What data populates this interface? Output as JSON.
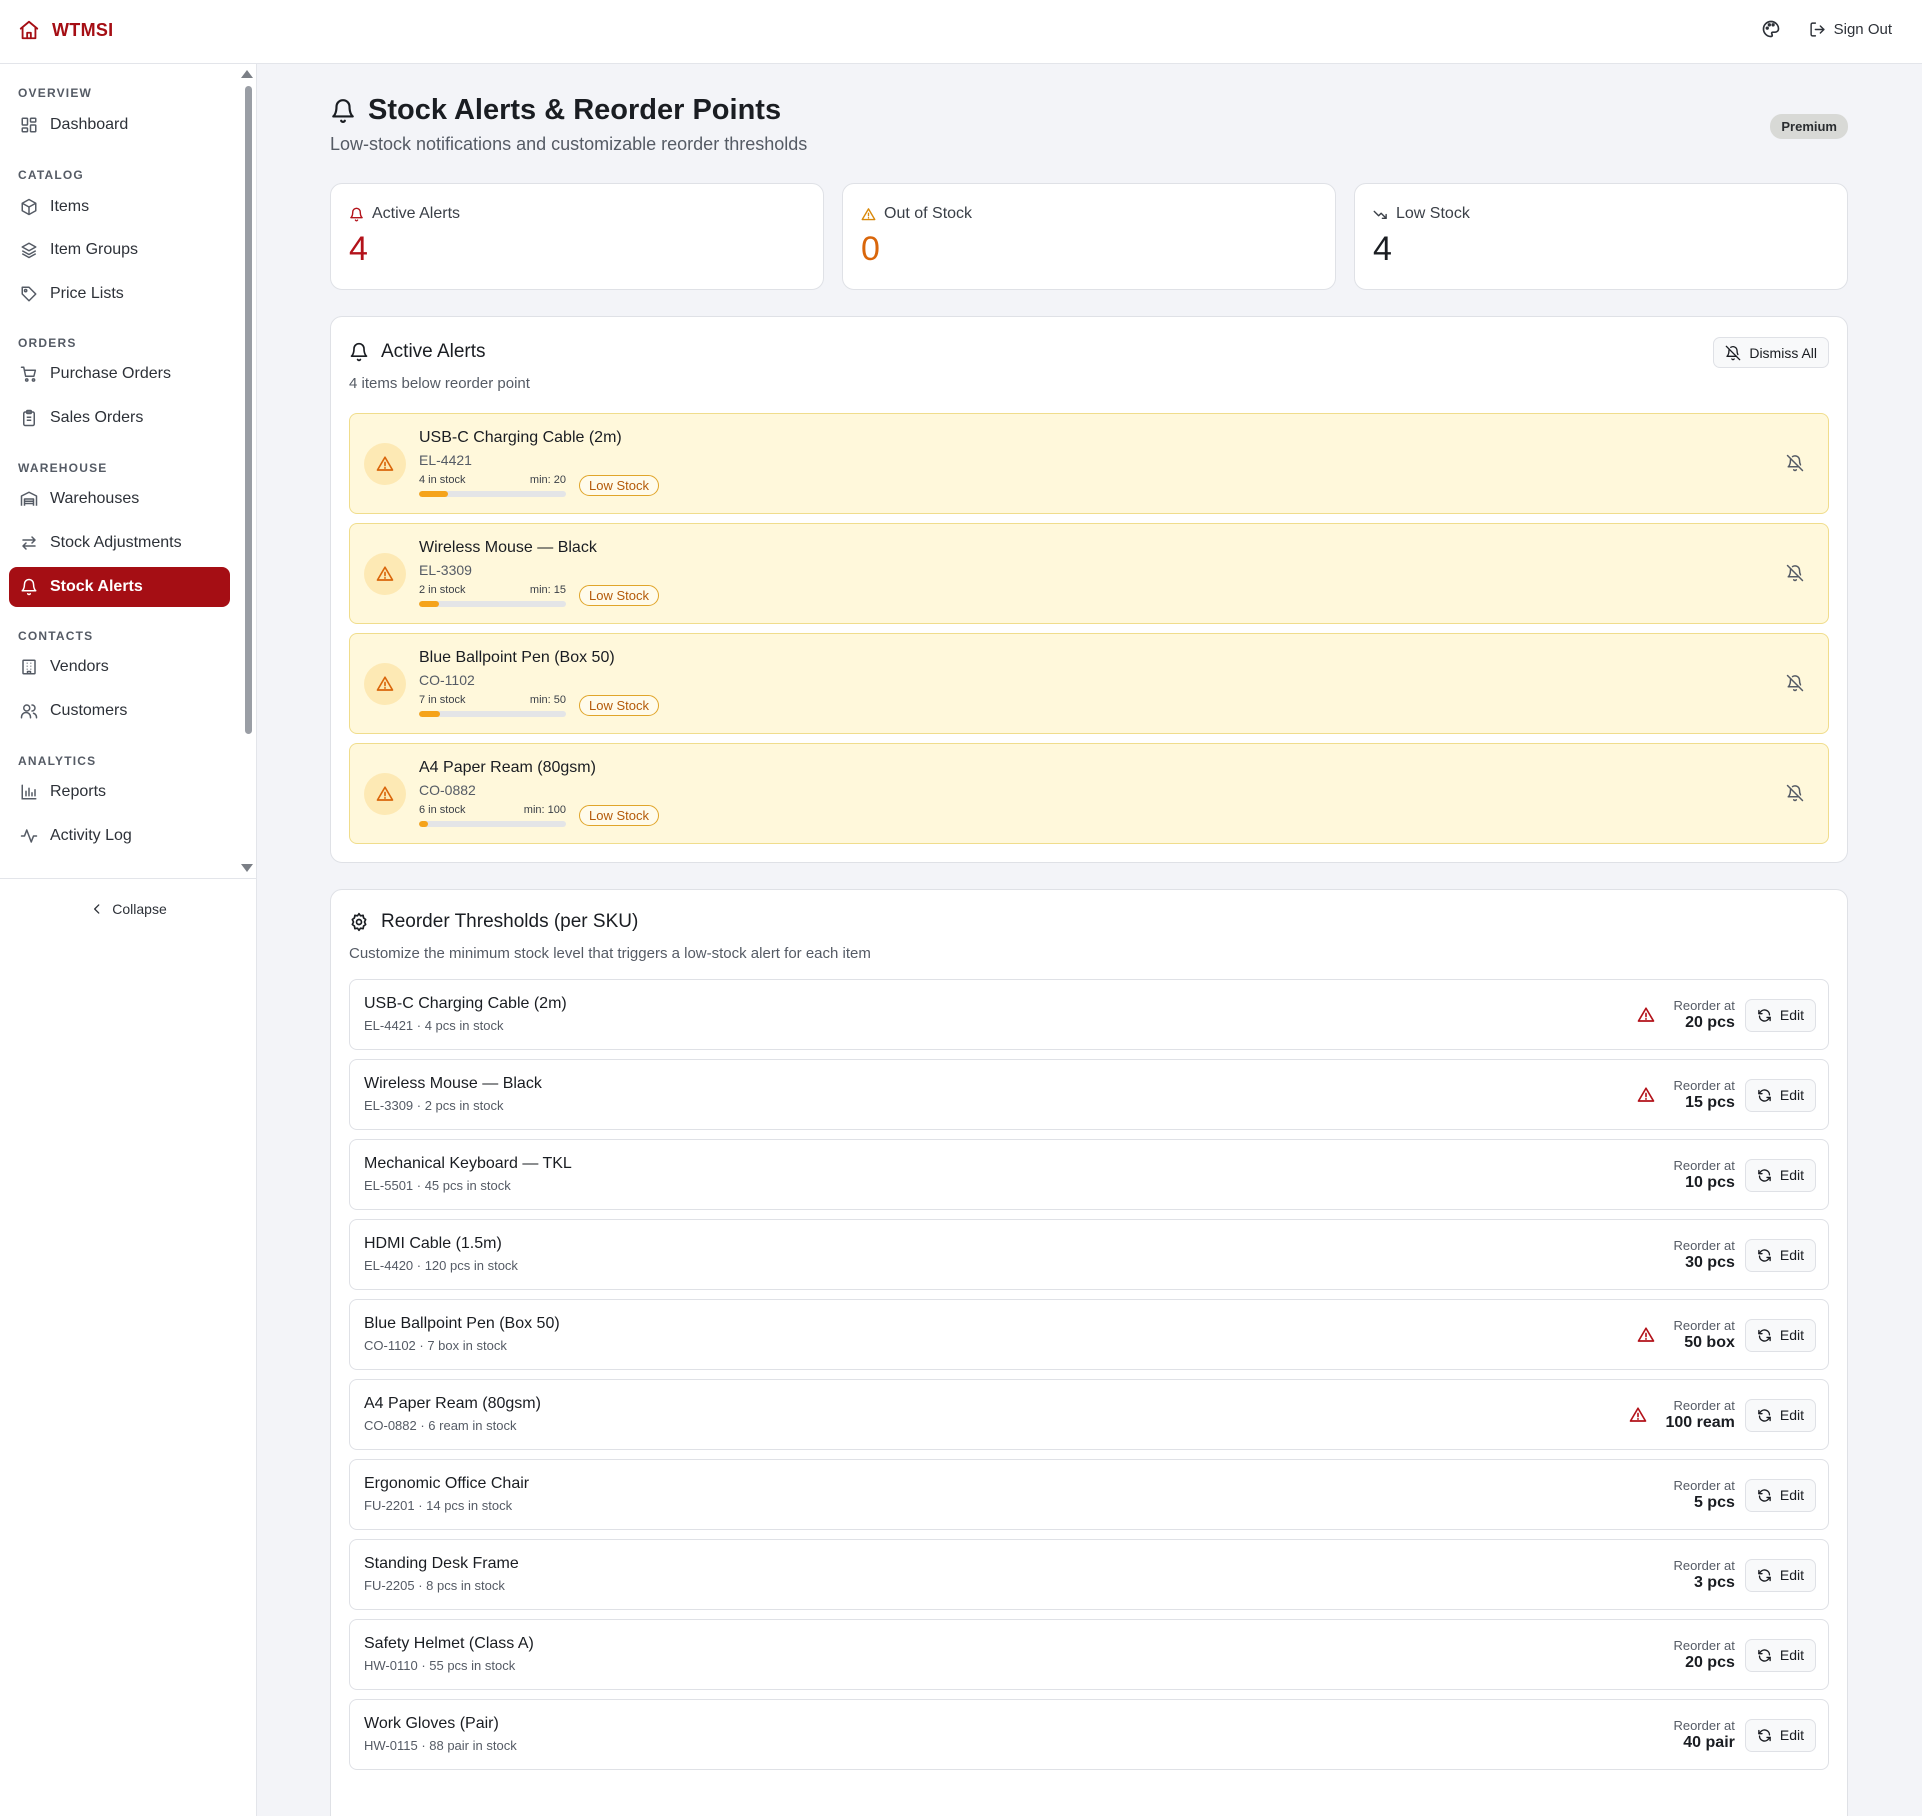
{
  "app": {
    "name": "WTMSI"
  },
  "header": {
    "signout_label": "Sign Out"
  },
  "sidebar": {
    "sections": [
      {
        "title": "OVERVIEW",
        "items": [
          {
            "label": "Dashboard",
            "icon": "dashboard-icon"
          }
        ]
      },
      {
        "title": "CATALOG",
        "items": [
          {
            "label": "Items",
            "icon": "box-icon"
          },
          {
            "label": "Item Groups",
            "icon": "layers-icon"
          },
          {
            "label": "Price Lists",
            "icon": "tag-icon"
          }
        ]
      },
      {
        "title": "ORDERS",
        "items": [
          {
            "label": "Purchase Orders",
            "icon": "cart-icon"
          },
          {
            "label": "Sales Orders",
            "icon": "clipboard-icon"
          }
        ]
      },
      {
        "title": "WAREHOUSE",
        "items": [
          {
            "label": "Warehouses",
            "icon": "warehouse-icon"
          },
          {
            "label": "Stock Adjustments",
            "icon": "arrows-icon"
          },
          {
            "label": "Stock Alerts",
            "icon": "bell-icon",
            "active": true
          }
        ]
      },
      {
        "title": "CONTACTS",
        "items": [
          {
            "label": "Vendors",
            "icon": "building-icon"
          },
          {
            "label": "Customers",
            "icon": "users-icon"
          }
        ]
      },
      {
        "title": "ANALYTICS",
        "items": [
          {
            "label": "Reports",
            "icon": "bar-chart-icon"
          },
          {
            "label": "Activity Log",
            "icon": "activity-icon"
          }
        ]
      }
    ],
    "collapse_label": "Collapse"
  },
  "page": {
    "title": "Stock Alerts & Reorder Points",
    "subtitle": "Low-stock notifications and customizable reorder thresholds",
    "badge": "Premium"
  },
  "stats": [
    {
      "label": "Active Alerts",
      "value": "4",
      "color": "#b3121a",
      "icon": "bell-icon"
    },
    {
      "label": "Out of Stock",
      "value": "0",
      "color": "#d9660b",
      "icon": "warning-icon"
    },
    {
      "label": "Low Stock",
      "value": "4",
      "color": "#1a1d22",
      "icon": "trending-down-icon"
    }
  ],
  "alerts_panel": {
    "title": "Active Alerts",
    "subtitle": "4 items below reorder point",
    "dismiss_label": "Dismiss All",
    "items": [
      {
        "name": "USB-C Charging Cable (2m)",
        "sku": "EL-4421",
        "stock_text": "4 in stock",
        "min_text": "min: 20",
        "fill": 0.2,
        "badge": "Low Stock"
      },
      {
        "name": "Wireless Mouse — Black",
        "sku": "EL-3309",
        "stock_text": "2 in stock",
        "min_text": "min: 15",
        "fill": 0.133,
        "badge": "Low Stock"
      },
      {
        "name": "Blue Ballpoint Pen (Box 50)",
        "sku": "CO-1102",
        "stock_text": "7 in stock",
        "min_text": "min: 50",
        "fill": 0.14,
        "badge": "Low Stock"
      },
      {
        "name": "A4 Paper Ream (80gsm)",
        "sku": "CO-0882",
        "stock_text": "6 in stock",
        "min_text": "min: 100",
        "fill": 0.06,
        "badge": "Low Stock"
      }
    ]
  },
  "thresholds_panel": {
    "title": "Reorder Thresholds (per SKU)",
    "subtitle": "Customize the minimum stock level that triggers a low-stock alert for each item",
    "reorder_label": "Reorder at",
    "edit_label": "Edit",
    "items": [
      {
        "name": "USB-C Charging Cable (2m)",
        "meta": "EL-4421 · 4 pcs in stock",
        "reorder": "20 pcs",
        "alert": true
      },
      {
        "name": "Wireless Mouse — Black",
        "meta": "EL-3309 · 2 pcs in stock",
        "reorder": "15 pcs",
        "alert": true
      },
      {
        "name": "Mechanical Keyboard — TKL",
        "meta": "EL-5501 · 45 pcs in stock",
        "reorder": "10 pcs",
        "alert": false
      },
      {
        "name": "HDMI Cable (1.5m)",
        "meta": "EL-4420 · 120 pcs in stock",
        "reorder": "30 pcs",
        "alert": false
      },
      {
        "name": "Blue Ballpoint Pen (Box 50)",
        "meta": "CO-1102 · 7 box in stock",
        "reorder": "50 box",
        "alert": true
      },
      {
        "name": "A4 Paper Ream (80gsm)",
        "meta": "CO-0882 · 6 ream in stock",
        "reorder": "100 ream",
        "alert": true
      },
      {
        "name": "Ergonomic Office Chair",
        "meta": "FU-2201 · 14 pcs in stock",
        "reorder": "5 pcs",
        "alert": false
      },
      {
        "name": "Standing Desk Frame",
        "meta": "FU-2205 · 8 pcs in stock",
        "reorder": "3 pcs",
        "alert": false
      },
      {
        "name": "Safety Helmet (Class A)",
        "meta": "HW-0110 · 55 pcs in stock",
        "reorder": "20 pcs",
        "alert": false
      },
      {
        "name": "Work Gloves (Pair)",
        "meta": "HW-0115 · 88 pair in stock",
        "reorder": "40 pair",
        "alert": false
      }
    ]
  },
  "colors": {
    "brand": "#a50e14",
    "alert_bg": "#fff8db",
    "meter": "#f5a31a"
  }
}
